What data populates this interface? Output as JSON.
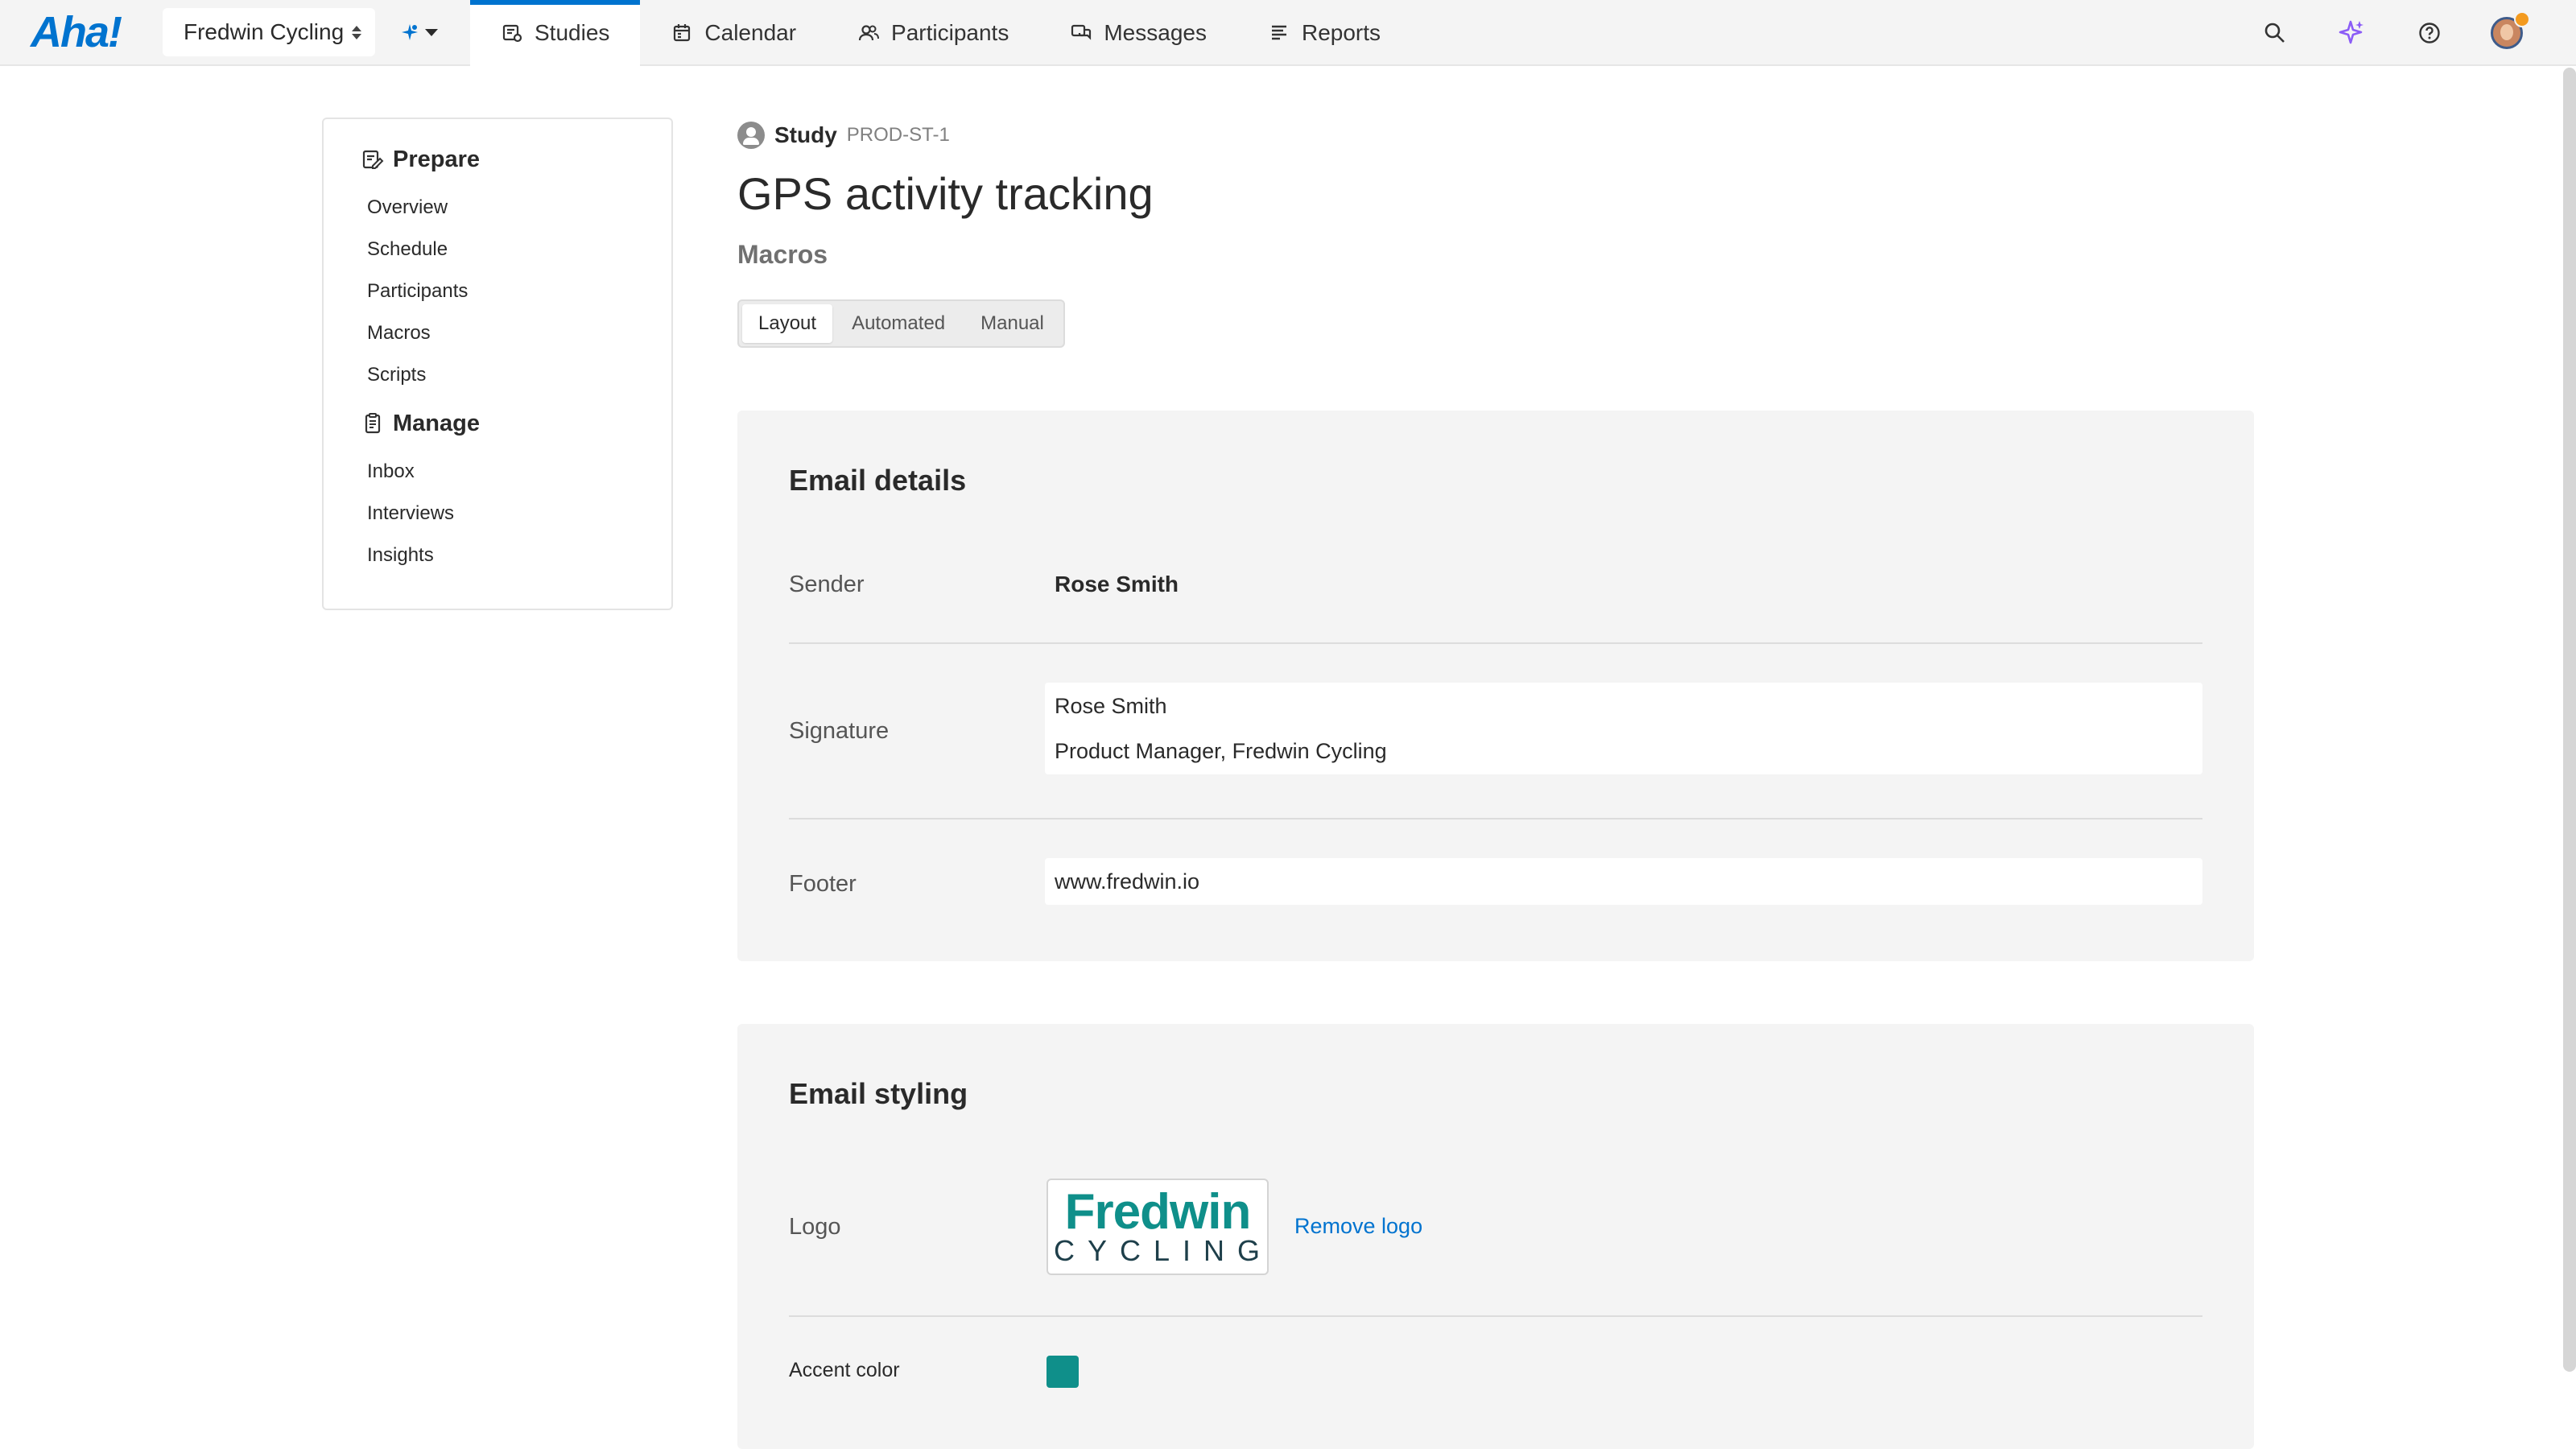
{
  "app": {
    "logo_text": "Aha!",
    "workspace_name": "Fredwin Cycling"
  },
  "nav": {
    "tabs": [
      {
        "label": "Studies",
        "icon": "studies-icon",
        "active": true
      },
      {
        "label": "Calendar",
        "icon": "calendar-icon",
        "active": false
      },
      {
        "label": "Participants",
        "icon": "participants-icon",
        "active": false
      },
      {
        "label": "Messages",
        "icon": "messages-icon",
        "active": false
      },
      {
        "label": "Reports",
        "icon": "reports-icon",
        "active": false
      }
    ],
    "right_icons": [
      "search-icon",
      "ai-sparkle-icon",
      "help-icon",
      "user-avatar"
    ]
  },
  "sidebar": {
    "sections": [
      {
        "title": "Prepare",
        "icon": "prepare-icon",
        "items": [
          "Overview",
          "Schedule",
          "Participants",
          "Macros",
          "Scripts"
        ]
      },
      {
        "title": "Manage",
        "icon": "clipboard-icon",
        "items": [
          "Inbox",
          "Interviews",
          "Insights"
        ]
      }
    ]
  },
  "page": {
    "record_type": "Study",
    "record_ref": "PROD-ST-1",
    "title": "GPS activity tracking",
    "subtitle": "Macros",
    "segments": [
      {
        "label": "Layout",
        "selected": true
      },
      {
        "label": "Automated",
        "selected": false
      },
      {
        "label": "Manual",
        "selected": false
      }
    ]
  },
  "email_details": {
    "heading": "Email details",
    "sender_label": "Sender",
    "sender_value": "Rose Smith",
    "signature_label": "Signature",
    "signature_lines": [
      "Rose Smith",
      "Product Manager, Fredwin Cycling"
    ],
    "footer_label": "Footer",
    "footer_value": "www.fredwin.io"
  },
  "email_styling": {
    "heading": "Email styling",
    "logo_label": "Logo",
    "logo_brand": "Fredwin",
    "logo_sub": "CYCLING",
    "remove_logo_label": "Remove logo",
    "accent_label": "Accent color",
    "accent_color": "#0f8f8a"
  },
  "colors": {
    "brand_blue": "#0073cf",
    "ai_purple": "#8b5cf6",
    "notification_orange": "#f39a1f"
  }
}
